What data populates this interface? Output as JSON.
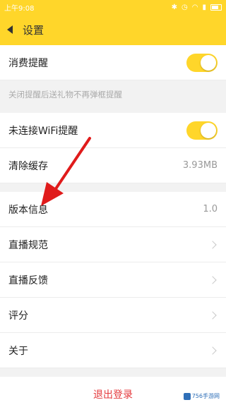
{
  "statusbar": {
    "time": "上午9:08"
  },
  "header": {
    "title": "设置"
  },
  "settings": {
    "consumption_reminder": {
      "label": "消费提醒",
      "enabled": true
    },
    "consumption_hint": "关闭提醒后送礼物不再弹框提醒",
    "wifi_reminder": {
      "label": "未连接WiFi提醒",
      "enabled": true
    },
    "clear_cache": {
      "label": "清除缓存",
      "value": "3.93MB"
    },
    "version": {
      "label": "版本信息",
      "value": "1.0"
    },
    "live_rules": {
      "label": "直播规范"
    },
    "live_feedback": {
      "label": "直播反馈"
    },
    "rating": {
      "label": "评分"
    },
    "about": {
      "label": "关于"
    }
  },
  "logout": {
    "label": "退出登录"
  },
  "watermark": {
    "text": "756手游网"
  },
  "colors": {
    "accent": "#ffd62a",
    "logout": "#e4393c",
    "arrow": "#e01b1b"
  }
}
